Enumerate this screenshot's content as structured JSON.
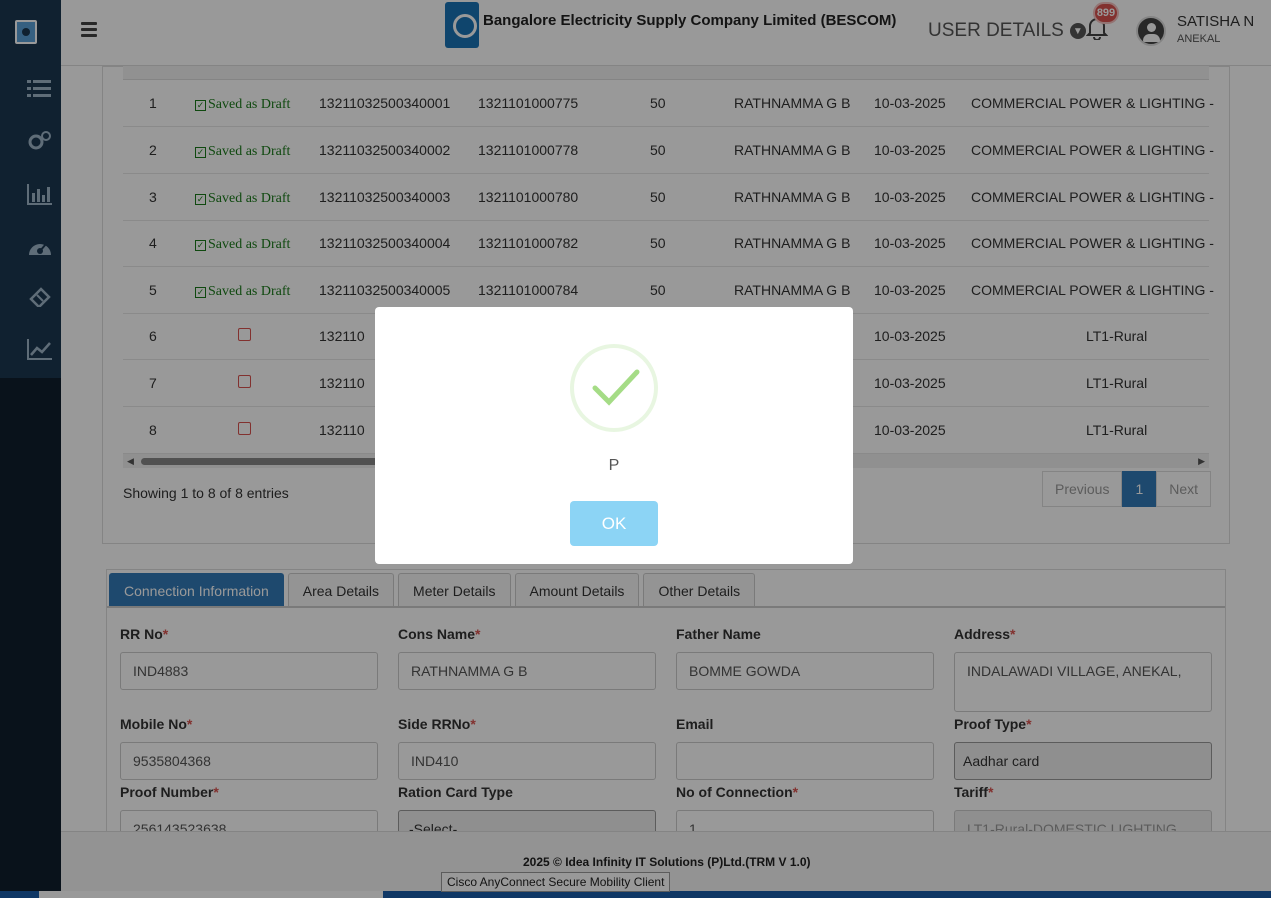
{
  "header": {
    "brand_title": "Bangalore Electricity Supply Company Limited (BESCOM)",
    "user_details_label": "USER DETAILS",
    "notification_count": "899",
    "user_name": "SATISHA N",
    "user_location": "ANEKAL"
  },
  "table": {
    "rows": [
      {
        "sl": "1",
        "status": "Saved as Draft",
        "app_no": "13211032500340001",
        "ref_no": "1321101000775",
        "qty": "50",
        "name": "RATHNAMMA G B",
        "date": "10-03-2025",
        "category": "COMMERCIAL POWER & LIGHTING -"
      },
      {
        "sl": "2",
        "status": "Saved as Draft",
        "app_no": "13211032500340002",
        "ref_no": "1321101000778",
        "qty": "50",
        "name": "RATHNAMMA G B",
        "date": "10-03-2025",
        "category": "COMMERCIAL POWER & LIGHTING -"
      },
      {
        "sl": "3",
        "status": "Saved as Draft",
        "app_no": "13211032500340003",
        "ref_no": "1321101000780",
        "qty": "50",
        "name": "RATHNAMMA G B",
        "date": "10-03-2025",
        "category": "COMMERCIAL POWER & LIGHTING -"
      },
      {
        "sl": "4",
        "status": "Saved as Draft",
        "app_no": "13211032500340004",
        "ref_no": "1321101000782",
        "qty": "50",
        "name": "RATHNAMMA G B",
        "date": "10-03-2025",
        "category": "COMMERCIAL POWER & LIGHTING -"
      },
      {
        "sl": "5",
        "status": "Saved as Draft",
        "app_no": "13211032500340005",
        "ref_no": "1321101000784",
        "qty": "50",
        "name": "RATHNAMMA G B",
        "date": "10-03-2025",
        "category": "COMMERCIAL POWER & LIGHTING -"
      },
      {
        "sl": "6",
        "status": "",
        "app_no": "132110",
        "ref_no": "",
        "qty": "",
        "name": "",
        "date": "10-03-2025",
        "category": "LT1-Rural"
      },
      {
        "sl": "7",
        "status": "",
        "app_no": "132110",
        "ref_no": "",
        "qty": "",
        "name": "",
        "date": "10-03-2025",
        "category": "LT1-Rural"
      },
      {
        "sl": "8",
        "status": "",
        "app_no": "132110",
        "ref_no": "",
        "qty": "",
        "name": "",
        "date": "10-03-2025",
        "category": "LT1-Rural"
      }
    ],
    "showing_text": "Showing 1 to 8 of 8 entries",
    "pager": {
      "previous": "Previous",
      "current": "1",
      "next": "Next"
    }
  },
  "tabs": [
    "Connection Information",
    "Area Details",
    "Meter Details",
    "Amount Details",
    "Other Details"
  ],
  "form": {
    "rr_no": {
      "label": "RR No",
      "value": "IND4883"
    },
    "cons_name": {
      "label": "Cons Name",
      "value": "RATHNAMMA G B"
    },
    "father_name": {
      "label": "Father Name",
      "value": "BOMME GOWDA"
    },
    "address": {
      "label": "Address",
      "value": "INDALAWADI VILLAGE,  ANEKAL,"
    },
    "mobile_no": {
      "label": "Mobile No",
      "value": "9535804368"
    },
    "side_rrno": {
      "label": "Side RRNo",
      "value": "IND410"
    },
    "email": {
      "label": "Email",
      "value": ""
    },
    "proof_type": {
      "label": "Proof Type",
      "value": "Aadhar card"
    },
    "proof_number": {
      "label": "Proof Number",
      "value": "256143523638"
    },
    "ration_card_type": {
      "label": "Ration Card Type",
      "value": "-Select-"
    },
    "no_of_connection": {
      "label": "No of Connection",
      "value": "1"
    },
    "tariff": {
      "label": "Tariff",
      "value": "LT1-Rural-DOMESTIC LIGHTING"
    }
  },
  "footer": {
    "text": "2025 © Idea Infinity IT Solutions (P)Ltd.(TRM V 1.0)"
  },
  "tooltip": "Cisco AnyConnect Secure Mobility Client",
  "modal": {
    "message": "P",
    "ok_label": "OK"
  },
  "colors": {
    "sidebar": "#1c3750",
    "primary": "#337ab7",
    "ok_button": "#8cd4f5",
    "success": "#a5dc86",
    "draft_green": "#1a7a1a",
    "required_red": "#d9534f"
  }
}
